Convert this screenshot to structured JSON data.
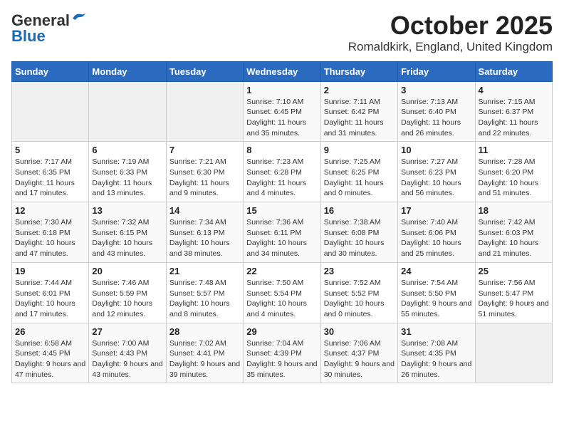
{
  "header": {
    "logo_general": "General",
    "logo_blue": "Blue",
    "title": "October 2025",
    "subtitle": "Romaldkirk, England, United Kingdom"
  },
  "weekdays": [
    "Sunday",
    "Monday",
    "Tuesday",
    "Wednesday",
    "Thursday",
    "Friday",
    "Saturday"
  ],
  "weeks": [
    [
      {
        "day": "",
        "sunrise": "",
        "sunset": "",
        "daylight": ""
      },
      {
        "day": "",
        "sunrise": "",
        "sunset": "",
        "daylight": ""
      },
      {
        "day": "",
        "sunrise": "",
        "sunset": "",
        "daylight": ""
      },
      {
        "day": "1",
        "sunrise": "Sunrise: 7:10 AM",
        "sunset": "Sunset: 6:45 PM",
        "daylight": "Daylight: 11 hours and 35 minutes."
      },
      {
        "day": "2",
        "sunrise": "Sunrise: 7:11 AM",
        "sunset": "Sunset: 6:42 PM",
        "daylight": "Daylight: 11 hours and 31 minutes."
      },
      {
        "day": "3",
        "sunrise": "Sunrise: 7:13 AM",
        "sunset": "Sunset: 6:40 PM",
        "daylight": "Daylight: 11 hours and 26 minutes."
      },
      {
        "day": "4",
        "sunrise": "Sunrise: 7:15 AM",
        "sunset": "Sunset: 6:37 PM",
        "daylight": "Daylight: 11 hours and 22 minutes."
      }
    ],
    [
      {
        "day": "5",
        "sunrise": "Sunrise: 7:17 AM",
        "sunset": "Sunset: 6:35 PM",
        "daylight": "Daylight: 11 hours and 17 minutes."
      },
      {
        "day": "6",
        "sunrise": "Sunrise: 7:19 AM",
        "sunset": "Sunset: 6:33 PM",
        "daylight": "Daylight: 11 hours and 13 minutes."
      },
      {
        "day": "7",
        "sunrise": "Sunrise: 7:21 AM",
        "sunset": "Sunset: 6:30 PM",
        "daylight": "Daylight: 11 hours and 9 minutes."
      },
      {
        "day": "8",
        "sunrise": "Sunrise: 7:23 AM",
        "sunset": "Sunset: 6:28 PM",
        "daylight": "Daylight: 11 hours and 4 minutes."
      },
      {
        "day": "9",
        "sunrise": "Sunrise: 7:25 AM",
        "sunset": "Sunset: 6:25 PM",
        "daylight": "Daylight: 11 hours and 0 minutes."
      },
      {
        "day": "10",
        "sunrise": "Sunrise: 7:27 AM",
        "sunset": "Sunset: 6:23 PM",
        "daylight": "Daylight: 10 hours and 56 minutes."
      },
      {
        "day": "11",
        "sunrise": "Sunrise: 7:28 AM",
        "sunset": "Sunset: 6:20 PM",
        "daylight": "Daylight: 10 hours and 51 minutes."
      }
    ],
    [
      {
        "day": "12",
        "sunrise": "Sunrise: 7:30 AM",
        "sunset": "Sunset: 6:18 PM",
        "daylight": "Daylight: 10 hours and 47 minutes."
      },
      {
        "day": "13",
        "sunrise": "Sunrise: 7:32 AM",
        "sunset": "Sunset: 6:15 PM",
        "daylight": "Daylight: 10 hours and 43 minutes."
      },
      {
        "day": "14",
        "sunrise": "Sunrise: 7:34 AM",
        "sunset": "Sunset: 6:13 PM",
        "daylight": "Daylight: 10 hours and 38 minutes."
      },
      {
        "day": "15",
        "sunrise": "Sunrise: 7:36 AM",
        "sunset": "Sunset: 6:11 PM",
        "daylight": "Daylight: 10 hours and 34 minutes."
      },
      {
        "day": "16",
        "sunrise": "Sunrise: 7:38 AM",
        "sunset": "Sunset: 6:08 PM",
        "daylight": "Daylight: 10 hours and 30 minutes."
      },
      {
        "day": "17",
        "sunrise": "Sunrise: 7:40 AM",
        "sunset": "Sunset: 6:06 PM",
        "daylight": "Daylight: 10 hours and 25 minutes."
      },
      {
        "day": "18",
        "sunrise": "Sunrise: 7:42 AM",
        "sunset": "Sunset: 6:03 PM",
        "daylight": "Daylight: 10 hours and 21 minutes."
      }
    ],
    [
      {
        "day": "19",
        "sunrise": "Sunrise: 7:44 AM",
        "sunset": "Sunset: 6:01 PM",
        "daylight": "Daylight: 10 hours and 17 minutes."
      },
      {
        "day": "20",
        "sunrise": "Sunrise: 7:46 AM",
        "sunset": "Sunset: 5:59 PM",
        "daylight": "Daylight: 10 hours and 12 minutes."
      },
      {
        "day": "21",
        "sunrise": "Sunrise: 7:48 AM",
        "sunset": "Sunset: 5:57 PM",
        "daylight": "Daylight: 10 hours and 8 minutes."
      },
      {
        "day": "22",
        "sunrise": "Sunrise: 7:50 AM",
        "sunset": "Sunset: 5:54 PM",
        "daylight": "Daylight: 10 hours and 4 minutes."
      },
      {
        "day": "23",
        "sunrise": "Sunrise: 7:52 AM",
        "sunset": "Sunset: 5:52 PM",
        "daylight": "Daylight: 10 hours and 0 minutes."
      },
      {
        "day": "24",
        "sunrise": "Sunrise: 7:54 AM",
        "sunset": "Sunset: 5:50 PM",
        "daylight": "Daylight: 9 hours and 55 minutes."
      },
      {
        "day": "25",
        "sunrise": "Sunrise: 7:56 AM",
        "sunset": "Sunset: 5:47 PM",
        "daylight": "Daylight: 9 hours and 51 minutes."
      }
    ],
    [
      {
        "day": "26",
        "sunrise": "Sunrise: 6:58 AM",
        "sunset": "Sunset: 4:45 PM",
        "daylight": "Daylight: 9 hours and 47 minutes."
      },
      {
        "day": "27",
        "sunrise": "Sunrise: 7:00 AM",
        "sunset": "Sunset: 4:43 PM",
        "daylight": "Daylight: 9 hours and 43 minutes."
      },
      {
        "day": "28",
        "sunrise": "Sunrise: 7:02 AM",
        "sunset": "Sunset: 4:41 PM",
        "daylight": "Daylight: 9 hours and 39 minutes."
      },
      {
        "day": "29",
        "sunrise": "Sunrise: 7:04 AM",
        "sunset": "Sunset: 4:39 PM",
        "daylight": "Daylight: 9 hours and 35 minutes."
      },
      {
        "day": "30",
        "sunrise": "Sunrise: 7:06 AM",
        "sunset": "Sunset: 4:37 PM",
        "daylight": "Daylight: 9 hours and 30 minutes."
      },
      {
        "day": "31",
        "sunrise": "Sunrise: 7:08 AM",
        "sunset": "Sunset: 4:35 PM",
        "daylight": "Daylight: 9 hours and 26 minutes."
      },
      {
        "day": "",
        "sunrise": "",
        "sunset": "",
        "daylight": ""
      }
    ]
  ]
}
